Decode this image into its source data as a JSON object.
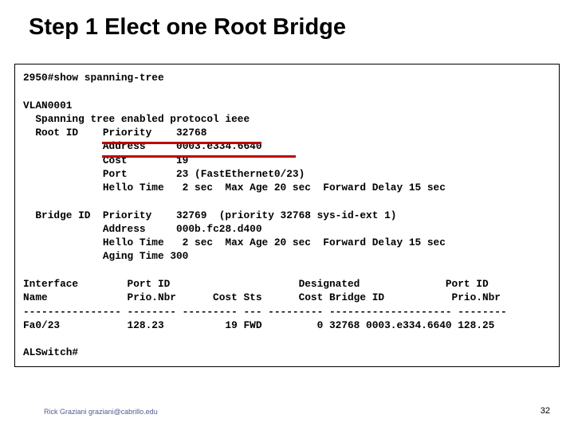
{
  "title": "Step 1   Elect one Root Bridge",
  "terminal": {
    "cmd": "2950#show spanning-tree",
    "vlan": "VLAN0001",
    "sp_line": "  Spanning tree enabled protocol ieee",
    "root_label": "  Root ID",
    "root_priority_label": "Priority",
    "root_priority_val": "32768",
    "root_address_label": "Address",
    "root_address_val": "0003.e334.6640",
    "root_cost_label": "Cost",
    "root_cost_val": "19",
    "root_port_label": "Port",
    "root_port_val": "23 (FastEthernet0/23)",
    "root_hello_label": "Hello Time",
    "root_hello_val": " 2 sec  Max Age 20 sec  Forward Delay 15 sec",
    "bridge_label": "  Bridge ID",
    "bridge_priority_label": "Priority",
    "bridge_priority_val": "32769  (priority 32768 sys-id-ext 1)",
    "bridge_address_label": "Address",
    "bridge_address_val": "000b.fc28.d400",
    "bridge_hello_label": "Hello Time",
    "bridge_hello_val": " 2 sec  Max Age 20 sec  Forward Delay 15 sec",
    "bridge_aging_label": "Aging Time",
    "bridge_aging_val": "300",
    "hdr1": "Interface        Port ID                     Designated              Port ID",
    "hdr2": "Name             Prio.Nbr      Cost Sts      Cost Bridge ID           Prio.Nbr",
    "sep": "---------------- -------- --------- --- --------- -------------------- --------",
    "row1": "Fa0/23           128.23          19 FWD         0 32768 0003.e334.6640 128.25",
    "prompt2": "ALSwitch#"
  },
  "footer": {
    "left": "Rick Graziani graziani@cabrillo.edu",
    "page": "32"
  }
}
